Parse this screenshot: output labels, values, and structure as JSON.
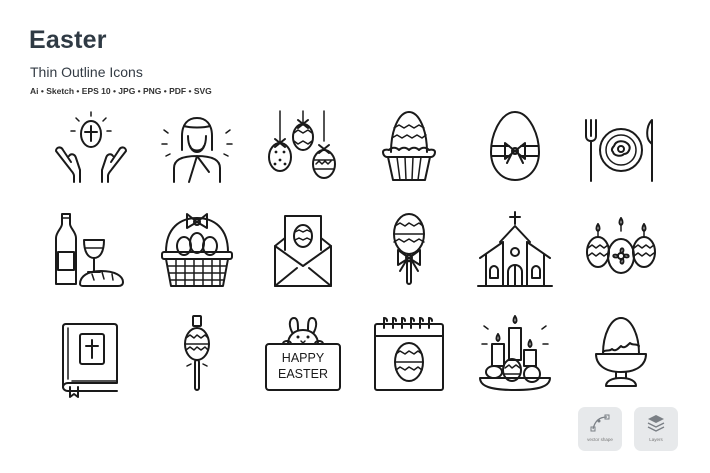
{
  "header": {
    "title": "Easter",
    "subtitle": "Thin Outline Icons",
    "formats": "Ai • Sketch • EPS 10 • JPG • PNG • PDF • SVG"
  },
  "icons": [
    "hands-holding-egg-icon",
    "jesus-icon",
    "hanging-eggs-icon",
    "egg-cupcake-icon",
    "egg-with-bow-icon",
    "easter-meal-icon",
    "wine-and-bread-icon",
    "egg-basket-icon",
    "egg-letter-icon",
    "egg-lollipop-icon",
    "church-icon",
    "egg-candles-icon",
    "bible-icon",
    "egg-on-stick-icon",
    "happy-easter-sign-icon",
    "egg-calendar-icon",
    "candles-and-eggs-plate-icon",
    "egg-cup-icon"
  ],
  "sign": {
    "line1": "HAPPY",
    "line2": "EASTER"
  },
  "badges": {
    "vector": "vector shape",
    "layers": "Layers"
  }
}
